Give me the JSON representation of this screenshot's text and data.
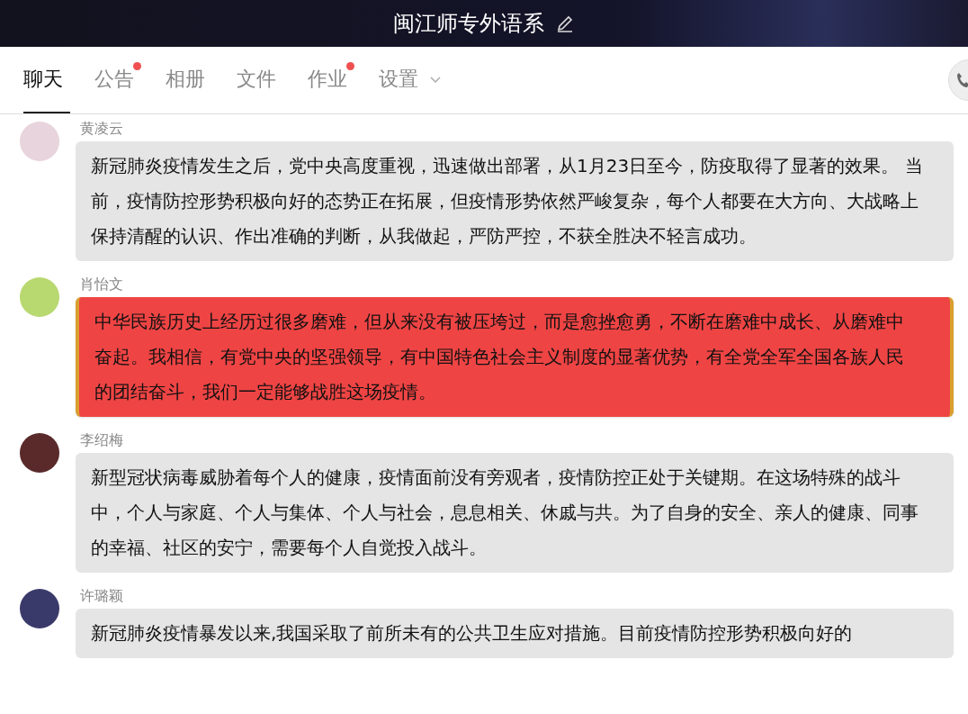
{
  "header": {
    "title": "闽江师专外语系"
  },
  "tabs": [
    {
      "label": "聊天",
      "selected": true,
      "badge": false,
      "dropdown": false
    },
    {
      "label": "公告",
      "selected": false,
      "badge": true,
      "dropdown": false
    },
    {
      "label": "相册",
      "selected": false,
      "badge": false,
      "dropdown": false
    },
    {
      "label": "文件",
      "selected": false,
      "badge": false,
      "dropdown": false
    },
    {
      "label": "作业",
      "selected": false,
      "badge": true,
      "dropdown": false
    },
    {
      "label": "设置",
      "selected": false,
      "badge": false,
      "dropdown": true
    }
  ],
  "messages": [
    {
      "sender": "黄凌云",
      "kind": "normal",
      "text": "新冠肺炎疫情发生之后，党中央高度重视，迅速做出部署，从1月23日至今，防疫取得了显著的效果。 当前，疫情防控形势积极向好的态势正在拓展，但疫情形势依然严峻复杂，每个人都要在大方向、大战略上保持清醒的认识、作出准确的判断，从我做起，严防严控，不获全胜决不轻言成功。"
    },
    {
      "sender": "肖怡文",
      "kind": "themed",
      "text": "中华民族历史上经历过很多磨难，但从来没有被压垮过，而是愈挫愈勇，不断在磨难中成长、从磨难中奋起。我相信，有党中央的坚强领导，有中国特色社会主义制度的显著优势，有全党全军全国各族人民的团结奋斗，我们一定能够战胜这场疫情。"
    },
    {
      "sender": "李绍梅",
      "kind": "normal",
      "text": "新型冠状病毒威胁着每个人的健康，疫情面前没有旁观者，疫情防控正处于关键期。在这场特殊的战斗中，个人与家庭、个人与集体、个人与社会，息息相关、休戚与共。为了自身的安全、亲人的健康、同事的幸福、社区的安宁，需要每个人自觉投入战斗。"
    },
    {
      "sender": "许璐颖",
      "kind": "normal",
      "text": "新冠肺炎疫情暴发以来,我国采取了前所未有的公共卫生应对措施。目前疫情防控形势积极向好的"
    }
  ]
}
